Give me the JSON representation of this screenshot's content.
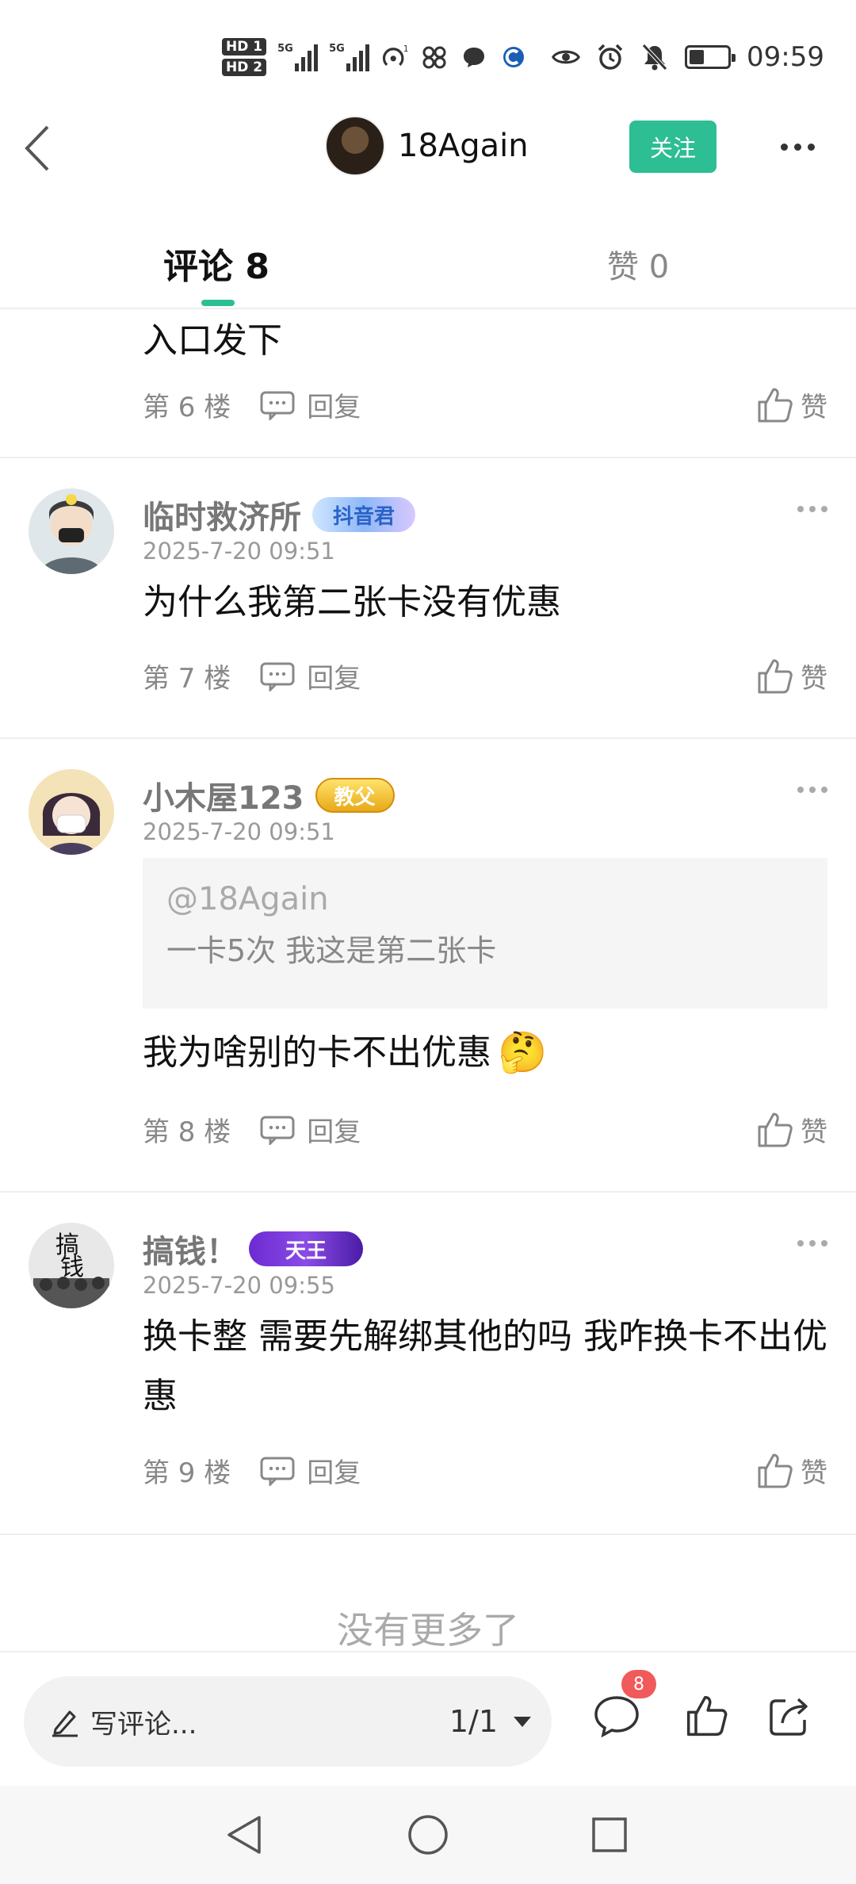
{
  "status_bar": {
    "time": "09:59",
    "hd1": "HD 1",
    "hd2": "HD 2",
    "sig1": "5G",
    "sig2": "5G",
    "hotspot_count": "1",
    "battery_level": 0.4
  },
  "header": {
    "author_name": "18Again",
    "follow_label": "关注"
  },
  "tabs": {
    "comments_label": "评论 8",
    "likes_label": "赞 0"
  },
  "comments": [
    {
      "text": "入口发下",
      "floor": "第 6 楼",
      "reply_label": "回复",
      "like_label": "赞"
    },
    {
      "name": "临时救济所",
      "badge": "抖音君",
      "time": "2025-7-20 09:51",
      "text": "为什么我第二张卡没有优惠",
      "floor": "第 7 楼",
      "reply_label": "回复",
      "like_label": "赞"
    },
    {
      "name": "小木屋123",
      "badge": "教父",
      "time": "2025-7-20 09:51",
      "quote_at": "@18Again",
      "quote_text": "一卡5次 我这是第二张卡",
      "text": "我为啥别的卡不出优惠",
      "emoji": "🤔",
      "floor": "第 8 楼",
      "reply_label": "回复",
      "like_label": "赞"
    },
    {
      "name": "搞钱！",
      "badge": "天王",
      "time": "2025-7-20 09:55",
      "text": "换卡整 需要先解绑其他的吗 我咋换卡不出优惠",
      "floor": "第 9 楼",
      "reply_label": "回复",
      "like_label": "赞"
    }
  ],
  "no_more": "没有更多了",
  "bottom_bar": {
    "placeholder": "写评论...",
    "page": "1/1",
    "comment_count": "8"
  },
  "colors": {
    "accent": "#2dbe94",
    "badge_red": "#f05a5a"
  }
}
